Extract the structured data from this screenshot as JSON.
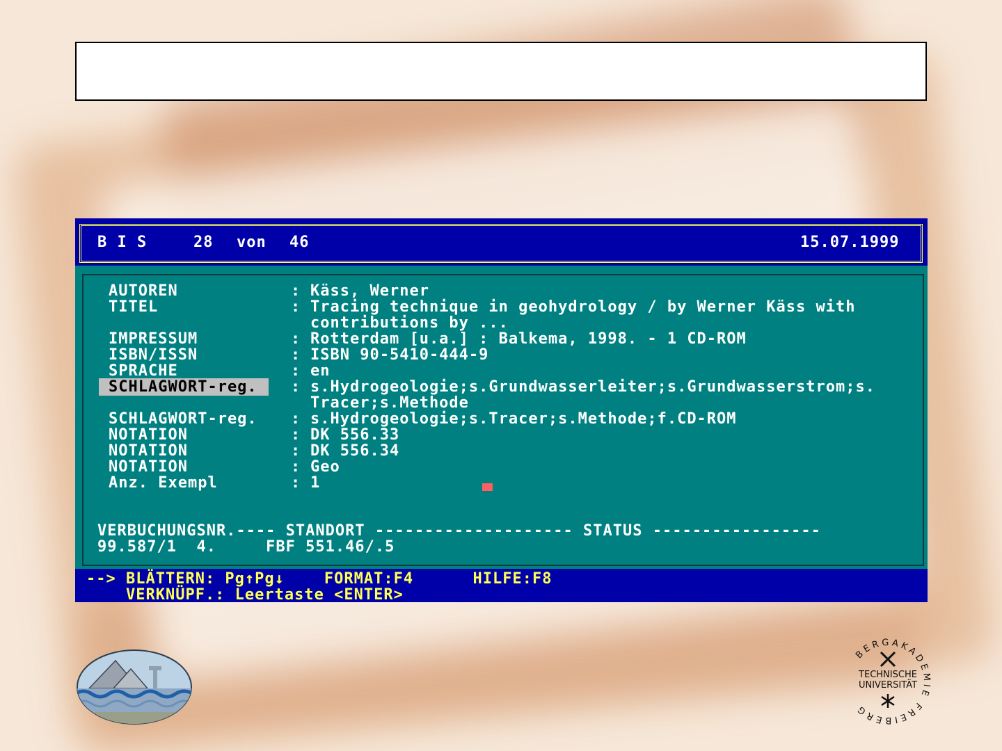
{
  "header": {
    "system": "B I S",
    "record_index": "28",
    "of_label": "von",
    "record_total": "46",
    "date": "15.07.1999"
  },
  "record": {
    "fields": [
      {
        "label": "AUTOREN",
        "value": "Käss, Werner"
      },
      {
        "label": "TITEL",
        "value": "Tracing technique in geohydrology / by Werner Käss with",
        "value_cont": "contributions by ..."
      },
      {
        "label": "IMPRESSUM",
        "value": "Rotterdam [u.a.] : Balkema, 1998. - 1 CD-ROM"
      },
      {
        "label": "ISBN/ISSN",
        "value": "ISBN 90-5410-444-9"
      },
      {
        "label": "SPRACHE",
        "value": "en"
      },
      {
        "label": "SCHLAGWORT-reg.",
        "value": "s.Hydrogeologie;s.Grundwasserleiter;s.Grundwasserstrom;s.",
        "value_cont": "Tracer;s.Methode"
      },
      {
        "label": "SCHLAGWORT-reg.",
        "value": "s.Hydrogeologie;s.Tracer;s.Methode;f.CD-ROM"
      },
      {
        "label": "NOTATION",
        "value": "DK 556.33"
      },
      {
        "label": "NOTATION",
        "value": "DK 556.34"
      },
      {
        "label": "NOTATION",
        "value": "Geo"
      },
      {
        "label": "Anz. Exempl",
        "value": "1"
      }
    ],
    "separator": ":"
  },
  "holdings": {
    "header_line": "VERBUCHUNGSNR.---- STANDORT -------------------- STATUS -----------------",
    "row_line": "99.587/1  4.     FBF 551.46/.5"
  },
  "footer": {
    "line1": "--> BLÄTTERN: Pg↑Pg↓    FORMAT:F4      HILFE:F8",
    "line2": "    VERKNÜPF.: Leertaste <ENTER>"
  },
  "logos": {
    "right_ring_text": "BERGAKADEMIE FREIBERG",
    "right_line1": "TECHNISCHE",
    "right_line2": "UNIVERSITÄT"
  },
  "colors": {
    "terminal_bg": "#008080",
    "bar_bg": "#0000a8",
    "bar_text": "#ffff55",
    "highlight": "#c0c0c0"
  }
}
